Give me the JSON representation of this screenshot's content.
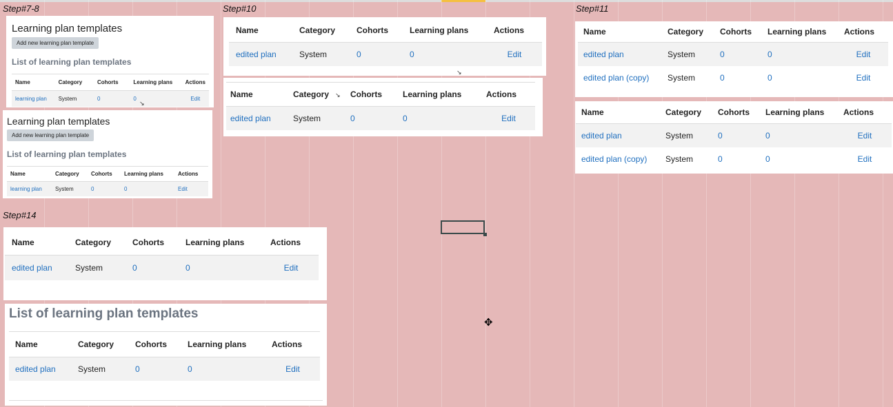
{
  "steps": {
    "s78": "Step#7-8",
    "s10": "Step#10",
    "s11": "Step#11",
    "s14": "Step#14"
  },
  "page": {
    "title": "Learning plan templates",
    "add_button": "Add new learning plan template",
    "list_title": "List of learning plan templates"
  },
  "table": {
    "headers": [
      "Name",
      "Category",
      "Cohorts",
      "Learning plans",
      "Actions"
    ]
  },
  "rows": {
    "original": {
      "name": "learning plan",
      "category": "System",
      "cohorts": "0",
      "plans": "0",
      "action": "Edit"
    },
    "edited": {
      "name": "edited plan",
      "category": "System",
      "cohorts": "0",
      "plans": "0",
      "action": "Edit"
    },
    "copy": {
      "name": "edited plan (copy)",
      "category": "System",
      "cohorts": "0",
      "plans": "0",
      "action": "Edit"
    }
  },
  "icons": {
    "cross": "cursor-crosshair-icon",
    "arrow": "mouse-pointer-icon"
  }
}
